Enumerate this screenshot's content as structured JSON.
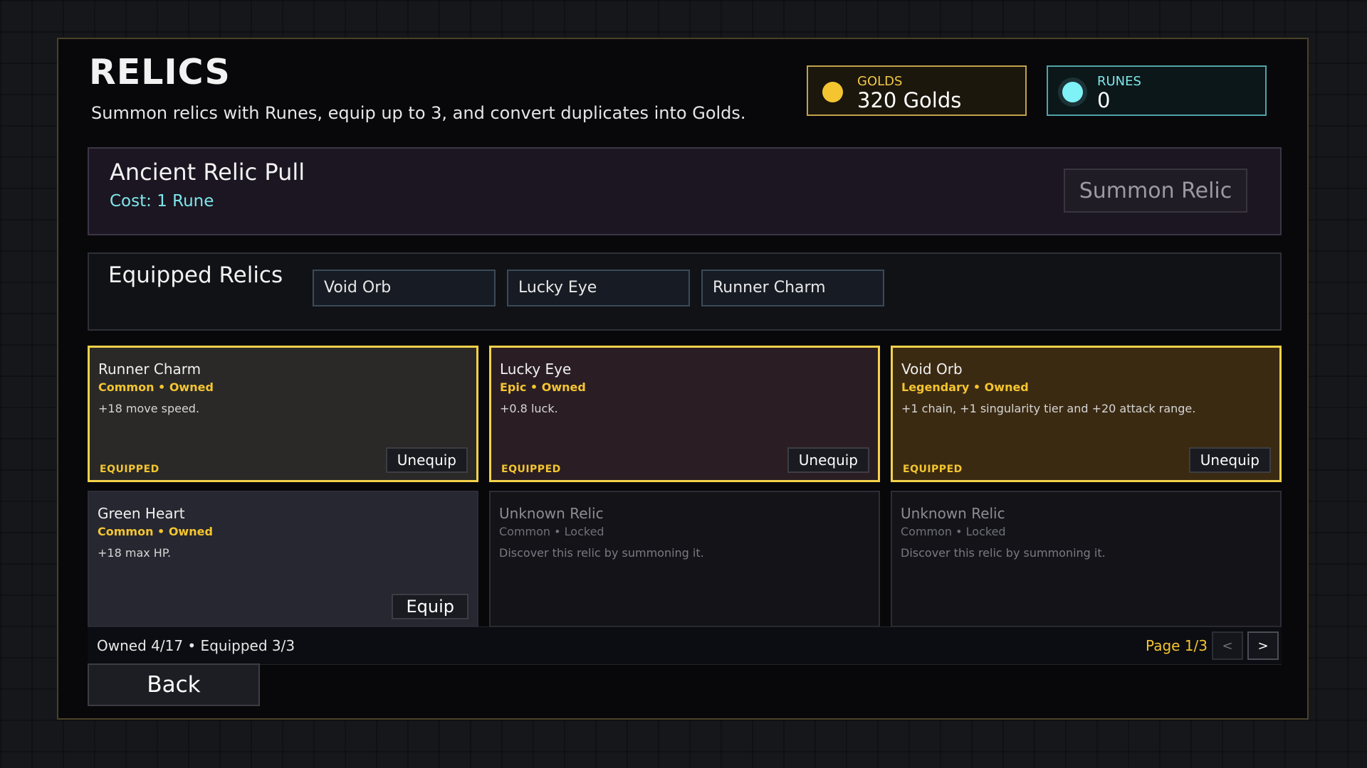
{
  "header": {
    "title": "RELICS",
    "subtitle": "Summon relics with Runes, equip up to 3, and convert duplicates into Golds."
  },
  "currency": {
    "gold": {
      "label": "GOLDS",
      "value": "320 Golds",
      "icon": "gold-coin-icon",
      "color": "#f4c530"
    },
    "runes": {
      "label": "RUNES",
      "value": "0",
      "icon": "rune-orb-icon",
      "color": "#7ef2f6"
    }
  },
  "pull": {
    "title": "Ancient Relic Pull",
    "cost": "Cost: 1 Rune",
    "summon_label": "Summon Relic"
  },
  "equipped": {
    "title": "Equipped Relics",
    "slots": [
      "Void Orb",
      "Lucky Eye",
      "Runner Charm"
    ]
  },
  "relics": [
    {
      "name": "Runner Charm",
      "meta": "Common • Owned",
      "desc": "+18 move speed.",
      "badge": "EQUIPPED",
      "button": "Unequip"
    },
    {
      "name": "Lucky Eye",
      "meta": "Epic • Owned",
      "desc": "+0.8 luck.",
      "badge": "EQUIPPED",
      "button": "Unequip"
    },
    {
      "name": "Void Orb",
      "meta": "Legendary • Owned",
      "desc": "+1 chain, +1 singularity tier and +20 attack range.",
      "badge": "EQUIPPED",
      "button": "Unequip"
    },
    {
      "name": "Green Heart",
      "meta": "Common • Owned",
      "desc": "+18 max HP.",
      "button": "Equip"
    },
    {
      "name": "Unknown Relic",
      "meta": "Common • Locked",
      "desc": "Discover this relic by summoning it."
    },
    {
      "name": "Unknown Relic",
      "meta": "Common • Locked",
      "desc": "Discover this relic by summoning it."
    }
  ],
  "footer": {
    "stats": "Owned 4/17 • Equipped 3/3",
    "page": "Page 1/3",
    "prev_label": "<",
    "next_label": ">"
  },
  "back_label": "Back",
  "colors": {
    "accent_gold": "#f4c530",
    "accent_cyan": "#7ef2f6",
    "equipped_border": "#f4d24a"
  }
}
